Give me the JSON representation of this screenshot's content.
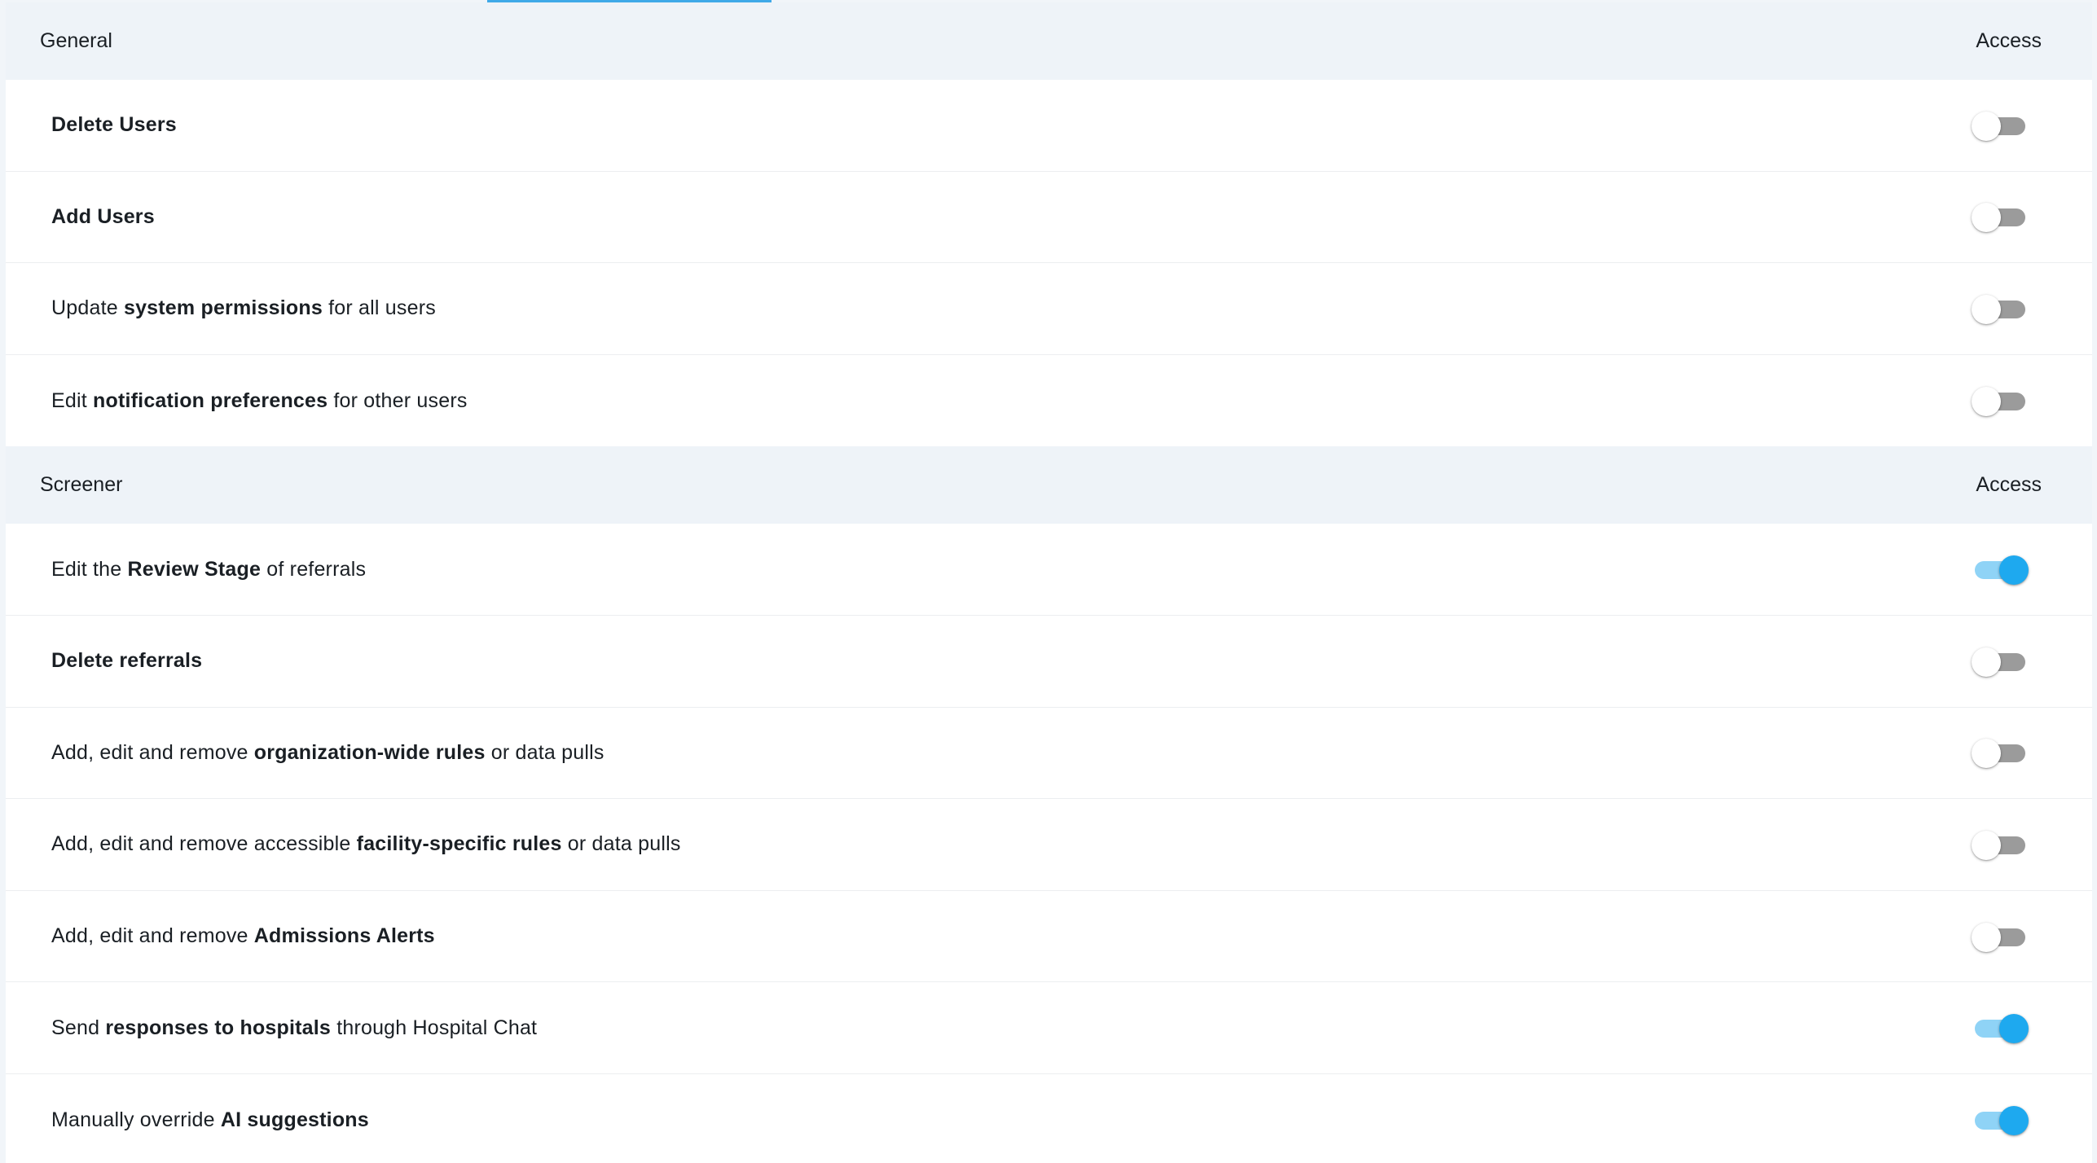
{
  "colors": {
    "accent": "#1ea9ef",
    "accent_track": "#8fd3f6",
    "off_track": "#9b9b9b",
    "header_bg": "#eef3f8"
  },
  "sections": [
    {
      "title": "General",
      "column_label": "Access",
      "rows": [
        {
          "parts": [
            {
              "text": "Delete Users",
              "bold": true
            }
          ],
          "enabled": false
        },
        {
          "parts": [
            {
              "text": "Add Users",
              "bold": true
            }
          ],
          "enabled": false
        },
        {
          "parts": [
            {
              "text": "Update ",
              "bold": false
            },
            {
              "text": "system permissions",
              "bold": true
            },
            {
              "text": " for all users",
              "bold": false
            }
          ],
          "enabled": false
        },
        {
          "parts": [
            {
              "text": "Edit ",
              "bold": false
            },
            {
              "text": "notification preferences",
              "bold": true
            },
            {
              "text": " for other users",
              "bold": false
            }
          ],
          "enabled": false
        }
      ]
    },
    {
      "title": "Screener",
      "column_label": "Access",
      "rows": [
        {
          "parts": [
            {
              "text": "Edit the ",
              "bold": false
            },
            {
              "text": "Review Stage",
              "bold": true
            },
            {
              "text": " of referrals",
              "bold": false
            }
          ],
          "enabled": true
        },
        {
          "parts": [
            {
              "text": "Delete referrals",
              "bold": true
            }
          ],
          "enabled": false
        },
        {
          "parts": [
            {
              "text": "Add, edit and remove ",
              "bold": false
            },
            {
              "text": "organization-wide rules",
              "bold": true
            },
            {
              "text": " or data pulls",
              "bold": false
            }
          ],
          "enabled": false
        },
        {
          "parts": [
            {
              "text": "Add, edit and remove accessible ",
              "bold": false
            },
            {
              "text": "facility-specific rules",
              "bold": true
            },
            {
              "text": " or data pulls",
              "bold": false
            }
          ],
          "enabled": false
        },
        {
          "parts": [
            {
              "text": "Add, edit and remove ",
              "bold": false
            },
            {
              "text": "Admissions Alerts",
              "bold": true
            }
          ],
          "enabled": false
        },
        {
          "parts": [
            {
              "text": "Send ",
              "bold": false
            },
            {
              "text": "responses to hospitals",
              "bold": true
            },
            {
              "text": " through Hospital Chat",
              "bold": false
            }
          ],
          "enabled": true
        },
        {
          "parts": [
            {
              "text": "Manually override ",
              "bold": false
            },
            {
              "text": "AI suggestions",
              "bold": true
            }
          ],
          "enabled": true
        }
      ]
    }
  ]
}
